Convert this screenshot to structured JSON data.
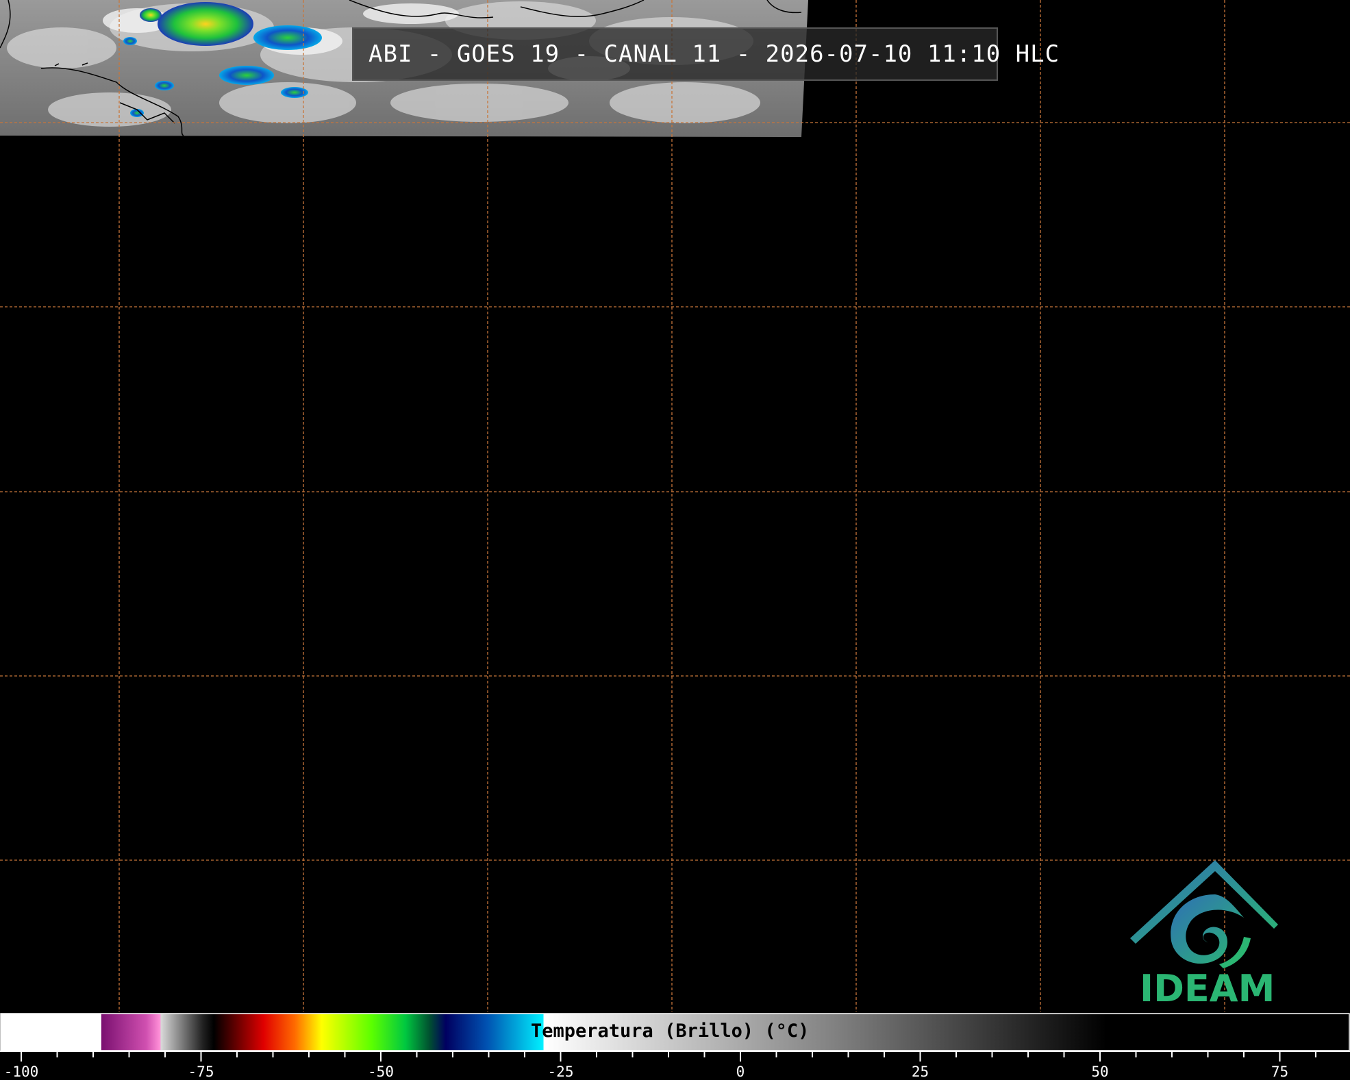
{
  "title": "ABI - GOES 19 - CANAL 11 - 2026-07-10 11:10 HLC",
  "logo_text": "IDEAM",
  "colorbar": {
    "label": "Temperatura (Brillo) (°C)",
    "min": -100,
    "max": 85,
    "tick_labels": [
      "-100",
      "-75",
      "-50",
      "-25",
      "0",
      "25",
      "50",
      "75"
    ],
    "tick_values": [
      -100,
      -75,
      -50,
      -25,
      0,
      25,
      50,
      75
    ]
  },
  "colors": {
    "background": "#000000",
    "grid_lines": "#c8763a",
    "logo_blue": "#2f6fb5",
    "logo_green": "#2bb673"
  }
}
